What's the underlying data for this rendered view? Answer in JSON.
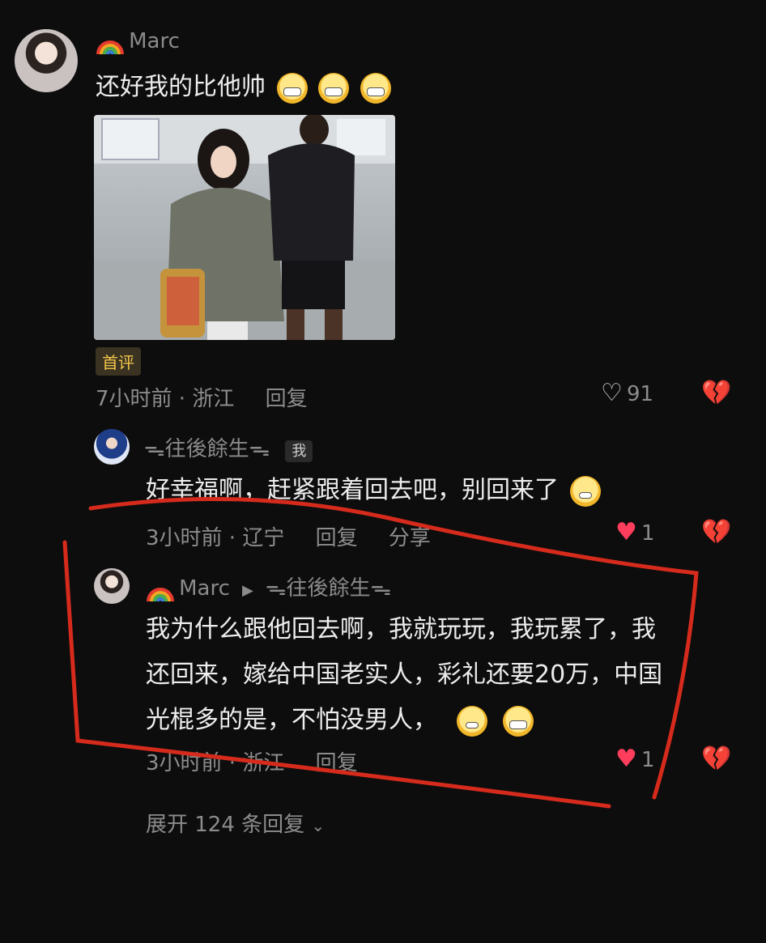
{
  "comments": [
    {
      "username": "Marc",
      "text": "还好我的比他帅",
      "badge": "首评",
      "time_location": "7小时前 · 浙江",
      "reply_label": "回复",
      "likes": "91"
    },
    {
      "username": "ᯓ往後餘生ᯓ",
      "tag": "我",
      "text": "好幸福啊，赶紧跟着回去吧，别回来了",
      "time_location": "3小时前 · 辽宁",
      "reply_label": "回复",
      "share_label": "分享",
      "likes": "1"
    },
    {
      "username": "Marc",
      "reply_to": "ᯓ往後餘生ᯓ",
      "text_lines": [
        "我为什么跟他回去啊，我就玩玩，我玩累了，我",
        "还回来，嫁给中国老实人，彩礼还要20万，中国",
        "光棍多的是，不怕没男人，"
      ],
      "time_location": "3小时前 · 浙江",
      "reply_label": "回复",
      "likes": "1"
    }
  ],
  "expand_label": "展开 124 条回复",
  "colors": {
    "background": "#0d0d0d",
    "heart": "#ff3d5c",
    "badge": "#f3c54b",
    "annotation": "#d62b1c"
  }
}
